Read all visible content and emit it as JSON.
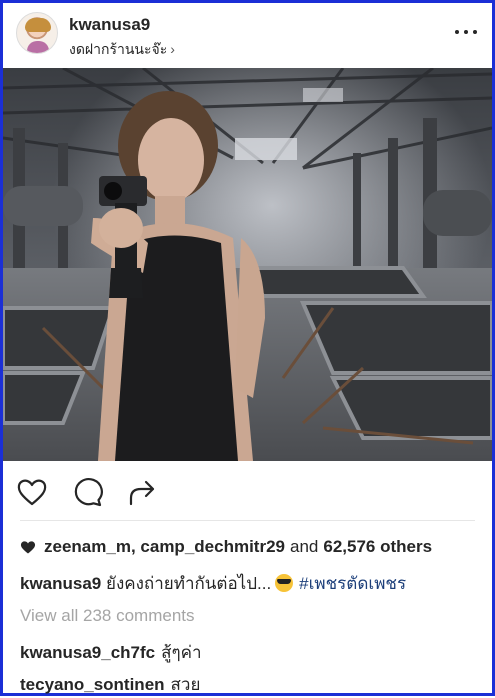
{
  "post": {
    "username": "kwanusa9",
    "location": "งดฝากร้านนะจ๊ะ",
    "location_chevron": "›",
    "avatar_icon": "profile-avatar",
    "more_icon": "more-horizontal-icon"
  },
  "actions": {
    "like_icon": "heart-outline-icon",
    "comment_icon": "comment-bubble-icon",
    "share_icon": "share-arrow-icon"
  },
  "likes": {
    "liker_1": "zeenam_m",
    "separator": ",",
    "liker_2": "camp_dechmitr29",
    "and_text": "and",
    "others": "62,576 others"
  },
  "caption": {
    "username": "kwanusa9",
    "text": "ยังคงถ่ายทำกันต่อไป...",
    "emoji": "sunglasses-emoji",
    "hashtag": "#เพชรตัดเพชร",
    "hashtag_color": "#1d3f7a"
  },
  "comments": {
    "view_all": "View all 238 comments",
    "items": [
      {
        "username": "kwanusa9_ch7fc",
        "text": "สู้ๆค่า"
      },
      {
        "username": "tecyano_sontinen",
        "text": "สวย"
      }
    ]
  },
  "colors": {
    "frame_border": "#1b2fd6",
    "text": "#262626",
    "muted": "#a5a5a5"
  }
}
